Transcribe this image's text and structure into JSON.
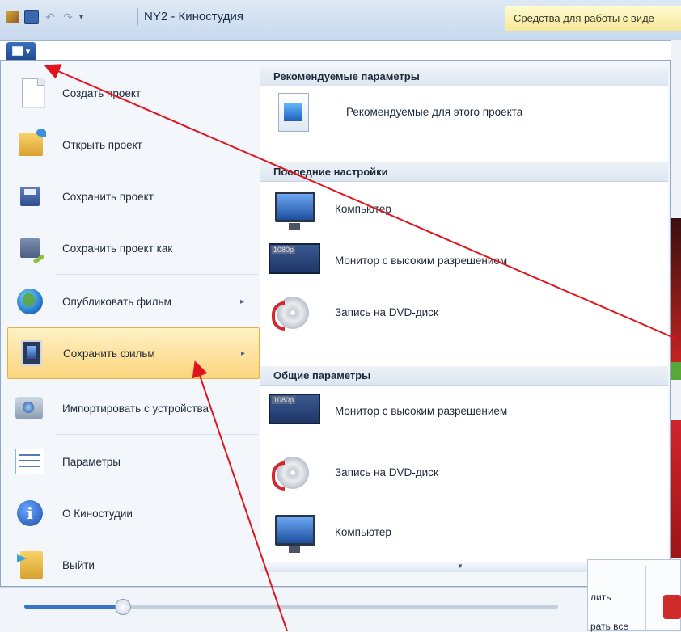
{
  "window": {
    "title": "NY2 - Киностудия",
    "contextual_tab": "Средства для работы с виде"
  },
  "left_menu": [
    {
      "label": "Создать проект",
      "icon": "new-document-icon"
    },
    {
      "label": "Открыть проект",
      "icon": "open-folder-icon"
    },
    {
      "label": "Сохранить проект",
      "icon": "save-floppy-icon"
    },
    {
      "label": "Сохранить проект как",
      "icon": "save-as-icon"
    },
    {
      "label": "Опубликовать фильм",
      "icon": "globe-icon",
      "submenu": true
    },
    {
      "label": "Сохранить фильм",
      "icon": "film-icon",
      "submenu": true,
      "highlighted": true
    },
    {
      "label": "Импортировать с устройства",
      "icon": "camera-import-icon"
    },
    {
      "label": "Параметры",
      "icon": "options-list-icon"
    },
    {
      "label": "О Киностудии",
      "icon": "info-icon"
    },
    {
      "label": "Выйти",
      "icon": "exit-icon"
    }
  ],
  "right_menu": {
    "recommended_header": "Рекомендуемые параметры",
    "recommended_item": "Рекомендуемые для этого проекта",
    "recent_header": "Последние настройки",
    "recent_items": [
      "Компьютер",
      "Монитор с высоким разрешением",
      "Запись на DVD-диск"
    ],
    "common_header": "Общие параметры",
    "common_items": [
      "Монитор с высоким разрешением",
      "Запись на DVD-диск",
      "Компьютер"
    ]
  },
  "bottom_panel": {
    "text1": "лить",
    "text2": "рать все"
  },
  "icons": {
    "submenu_arrow": "▸",
    "scroll_down": "▼",
    "menu_button": "▾"
  },
  "colors": {
    "annotation_arrow": "#e0141c",
    "highlight": "#fcd57d",
    "accent": "#1f4a8f"
  }
}
